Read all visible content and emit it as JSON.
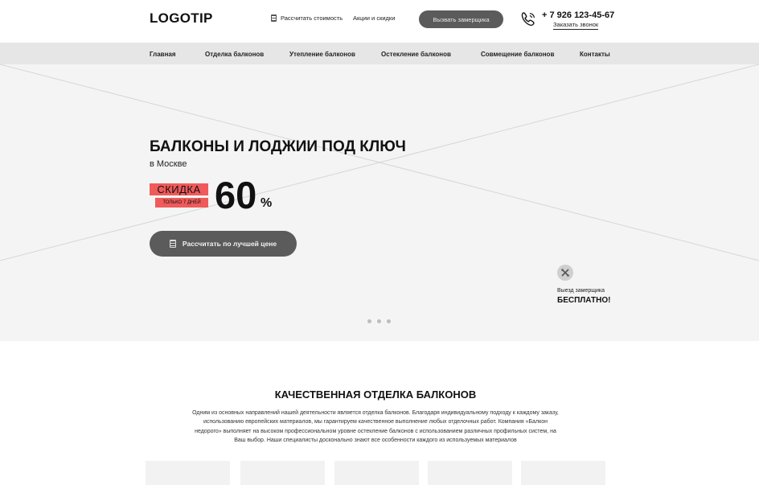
{
  "header": {
    "logo": "LOGOTIP",
    "calc_link": "Рассчитать стоимость",
    "promo_link": "Акции и скидки",
    "measure_button": "Вызвать замерщика",
    "phone": "+ 7 926 123-45-67",
    "callback": "Заказать звонок"
  },
  "nav": {
    "items": [
      {
        "label": "Главная"
      },
      {
        "label": "Отделка балконов"
      },
      {
        "label": "Утепление балконов"
      },
      {
        "label": "Остекление балконов"
      },
      {
        "label": "Совмещение балконов"
      },
      {
        "label": "Контакты"
      }
    ]
  },
  "hero": {
    "title": "БАЛКОНЫ И ЛОДЖИИ ПОД КЛЮЧ",
    "subtitle": "в Москве",
    "discount_label": "СКИДКА",
    "discount_note": "ТОЛЬКО 7 ДНЕЙ",
    "discount_value": "60",
    "percent": "%",
    "cta": "Рассчитать по лучшей цене",
    "badge_caption": "Выезд замерщика",
    "badge_strong": "БЕСПЛАТНО!",
    "slides_count": 3
  },
  "section": {
    "title": "КАЧЕСТВЕННАЯ ОТДЕЛКА БАЛКОНОВ",
    "text": "Одним из основных направлений нашей деятельности является отделка балконов. Благодаря индивидуальному подходу к каждому заказу, использованию европейских материалов, мы гарантируем качественное выполнение любых отделочных работ. Компания «Балкон недорого» выполняет на высоком профессиональном уровне остекление балконов с использованием различных профильных систем, на Ваш выбор. Наши специалисты досконально знают все особенности каждого из используемых материалов",
    "cards_count": 5
  },
  "icons": {
    "calc": "calculator-icon",
    "phone": "phone-icon",
    "badge": "measuring-tools-icon"
  },
  "colors": {
    "accent": "#f05a5a",
    "button": "#5b5b5b",
    "nav_bg": "#e6e6e6",
    "hero_bg": "#f4f4f4"
  }
}
